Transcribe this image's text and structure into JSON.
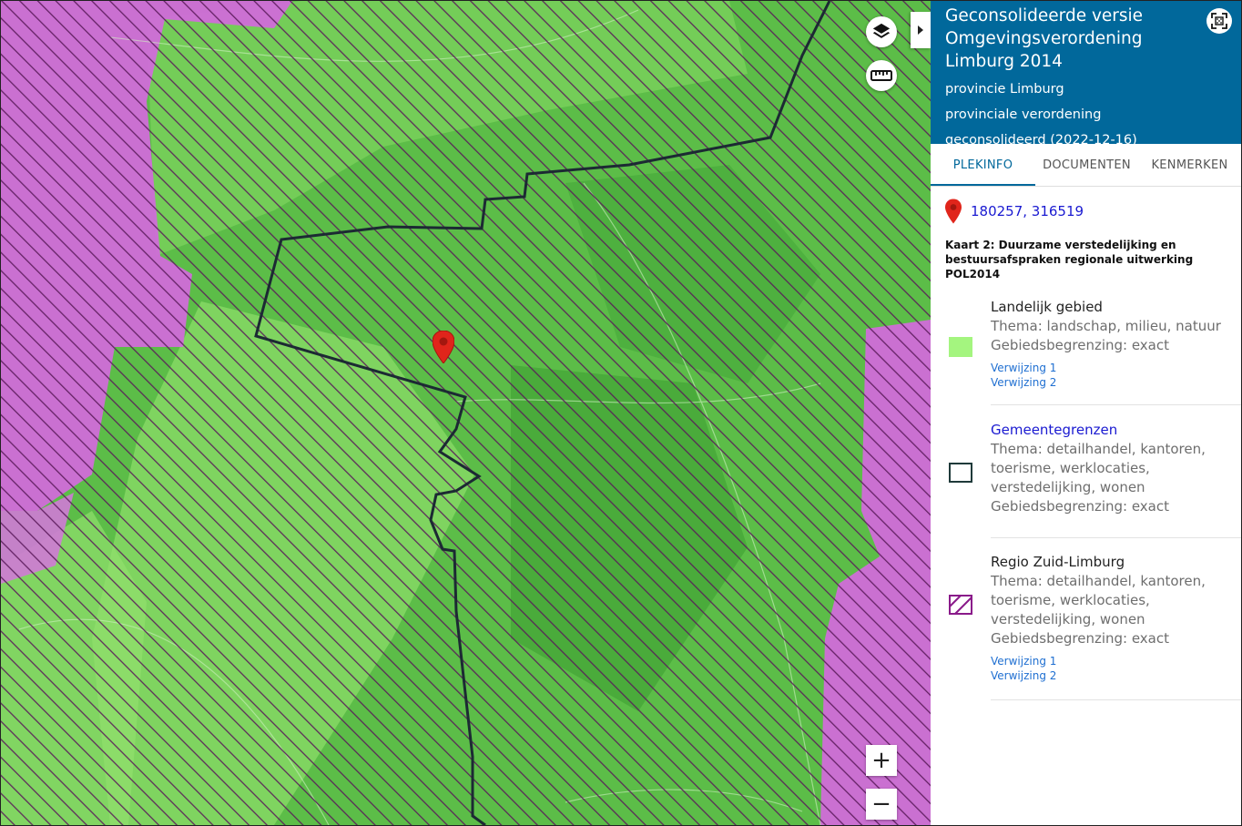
{
  "panel": {
    "title": "Geconsolideerde versie Omgevingsverordening Limburg 2014",
    "authority": "provincie Limburg",
    "doc_type": "provinciale verordening",
    "status": "geconsolideerd (2022-12-16)",
    "tabs": [
      {
        "label": "PLEKINFO",
        "active": true
      },
      {
        "label": "DOCUMENTEN",
        "active": false
      },
      {
        "label": "KENMERKEN",
        "active": false
      }
    ],
    "coordinates": "180257, 316519",
    "map_title": "Kaart 2: Duurzame verstedelijking en bestuursafspraken regionale uitwerking POL2014"
  },
  "legend": [
    {
      "name": "Landelijk gebied",
      "lines": [
        "Thema: landschap, milieu, natuur",
        "Gebiedsbegrenzing: exact"
      ],
      "links": [
        "Verwijzing 1",
        "Verwijzing 2"
      ],
      "swatch": "solid",
      "color": "#a4f57f"
    },
    {
      "name": "Gemeentegrenzen",
      "lines": [
        "Thema: detailhandel, kantoren,",
        "toerisme, werklocaties,",
        "verstedelijking, wonen",
        "Gebiedsbegrenzing: exact"
      ],
      "links": [],
      "swatch": "outline",
      "color": "#1f3a3a"
    },
    {
      "name": "Regio Zuid-Limburg",
      "lines": [
        "Thema: detailhandel, kantoren,",
        "toerisme, werklocaties,",
        "verstedelijking, wonen",
        "Gebiedsbegrenzing: exact"
      ],
      "links": [
        "Verwijzing 1",
        "Verwijzing 2"
      ],
      "swatch": "hatched",
      "color": "#8a1a8a"
    }
  ],
  "map": {
    "controls": {
      "zoom_in": "+",
      "zoom_out": "−"
    },
    "icons": [
      "layers-icon",
      "ruler-icon",
      "location-pin-icon",
      "fullscreen-icon",
      "chevron-right-icon"
    ]
  },
  "colors": {
    "header_bg": "#01689b",
    "link": "#1a1ad1",
    "landelijk_green": "#a4f57f",
    "regio_purple": "#8a1a8a"
  }
}
